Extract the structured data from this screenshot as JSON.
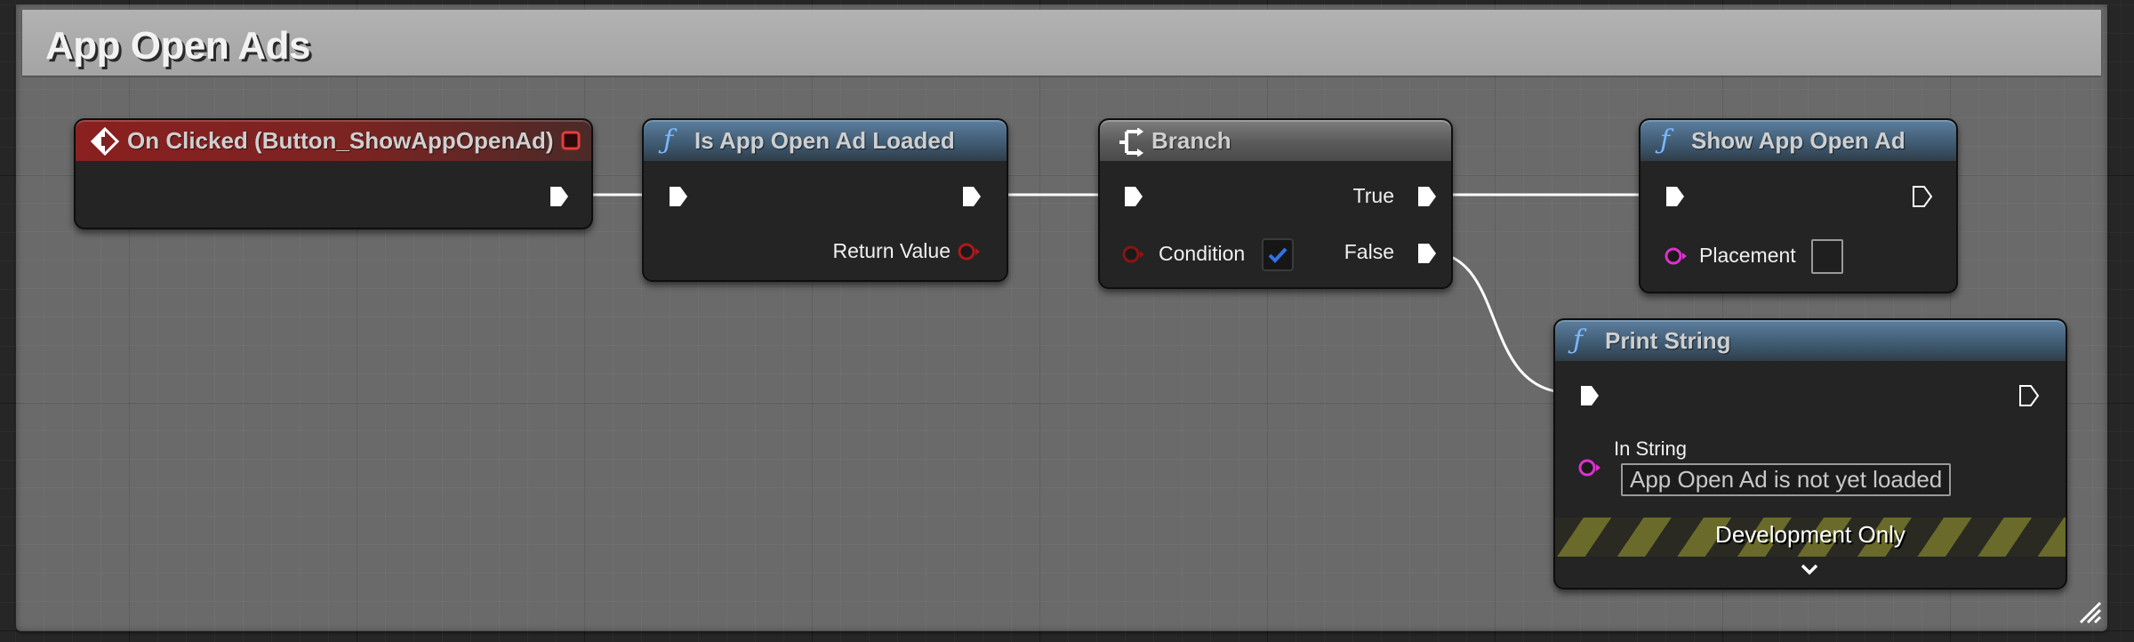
{
  "comment": {
    "title": "App Open Ads"
  },
  "nodes": {
    "on_clicked": {
      "title": "On Clicked (Button_ShowAppOpenAd)",
      "type": "event",
      "header_color": "#8a2020",
      "icon": "event-diamond-icon",
      "delegate_pin_color": "#e83c3c"
    },
    "is_loaded": {
      "title": "Is App Open Ad Loaded",
      "type": "function",
      "icon": "function-icon",
      "return_label": "Return Value",
      "return_pin_color": "#b01818"
    },
    "branch": {
      "title": "Branch",
      "type": "branch",
      "icon": "branch-icon",
      "condition_label": "Condition",
      "condition_checked": true,
      "true_label": "True",
      "false_label": "False"
    },
    "show_ad": {
      "title": "Show App Open Ad",
      "type": "function",
      "icon": "function-icon",
      "placement_label": "Placement",
      "placement_value": "",
      "placement_pin_color": "#e030d0"
    },
    "print_string": {
      "title": "Print String",
      "type": "function",
      "icon": "function-icon",
      "in_string_label": "In String",
      "in_string_value": "App Open Ad is not yet loaded",
      "in_string_pin_color": "#e030d0",
      "dev_only_label": "Development Only",
      "expand_icon": "chevron-down-icon"
    }
  },
  "colors": {
    "function_header": "#4a6a88",
    "branch_header": "#6a6a6a",
    "checkbox_check": "#2f72e6",
    "wire": "#ffffff"
  }
}
